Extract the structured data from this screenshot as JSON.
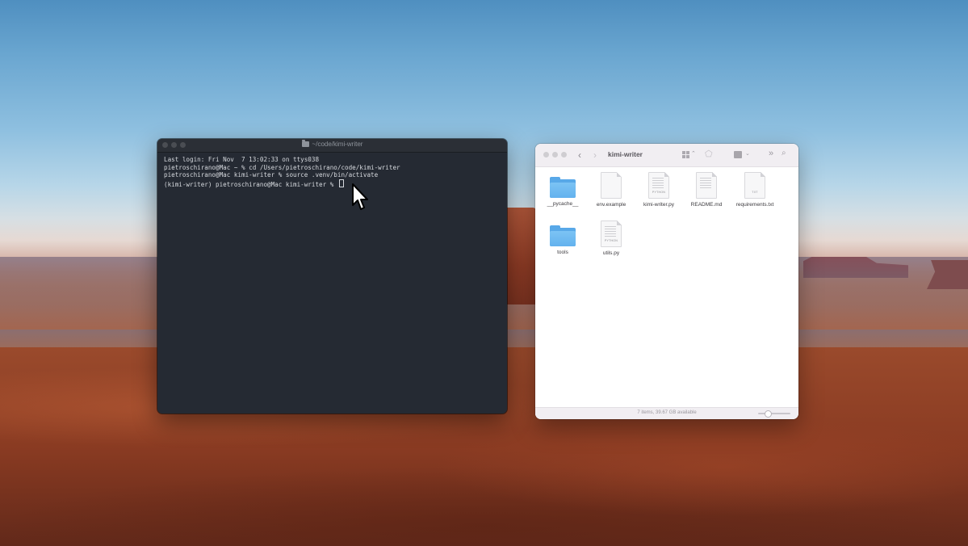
{
  "terminal": {
    "title": "~/code/kimi-writer",
    "lines": [
      "Last login: Fri Nov  7 13:02:33 on ttys038",
      "pietroschirano@Mac ~ % cd /Users/pietroschirano/code/kimi-writer",
      "pietroschirano@Mac kimi-writer % source .venv/bin/activate",
      "(kimi-writer) pietroschirano@Mac kimi-writer % "
    ]
  },
  "finder": {
    "title": "kimi-writer",
    "status": "7 items, 39.67 GB available",
    "files": [
      {
        "name": "__pycache__",
        "kind": "folder"
      },
      {
        "name": "env.example",
        "kind": "doc"
      },
      {
        "name": "kimi-writer.py",
        "kind": "python"
      },
      {
        "name": "README.md",
        "kind": "doc"
      },
      {
        "name": "requirements.txt",
        "kind": "txt"
      },
      {
        "name": "tools",
        "kind": "folder"
      },
      {
        "name": "utils.py",
        "kind": "python"
      }
    ],
    "tags": {
      "python": "PYTHON",
      "txt": "TXT"
    }
  },
  "colors": {
    "terminal_bg": "#252a33",
    "folder_blue": "#63b2ee"
  }
}
